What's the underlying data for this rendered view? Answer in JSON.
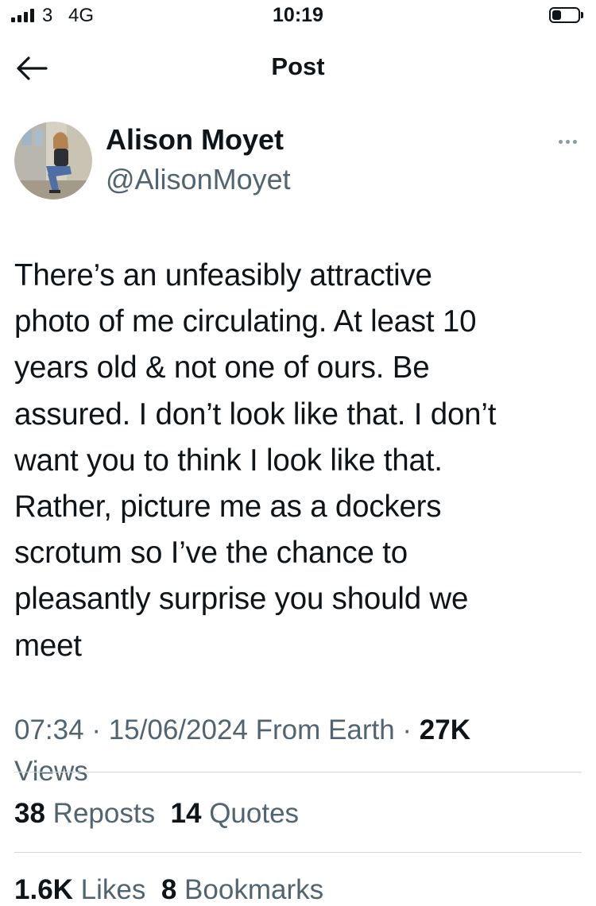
{
  "status_bar": {
    "carrier": "3",
    "network": "4G",
    "time": "10:19",
    "battery_level": 0.35,
    "icons": [
      "signal-bars-icon",
      "battery-icon"
    ]
  },
  "header": {
    "title": "Post",
    "back_icon": "arrow-left-icon"
  },
  "author": {
    "name": "Alison Moyet",
    "handle": "@AlisonMoyet",
    "more_icon": "more-horizontal-icon"
  },
  "tweet": {
    "lines": [
      "There’s an unfeasibly attractive",
      "photo of me circulating. At least 10",
      "years old & not one of ours. Be",
      "assured. I don’t  look like that. I don’t",
      "want you to think I look like that.",
      "Rather, picture me as a dockers",
      "scrotum so I’ve the chance to",
      "pleasantly surprise you should we",
      "meet"
    ]
  },
  "meta": {
    "time": "07:34",
    "date": "15/06/2024",
    "source": "From Earth",
    "separator": "·",
    "views_count": "27K",
    "views_label": "Views"
  },
  "stats": {
    "reposts_count": "38",
    "reposts_label": "Reposts",
    "quotes_count": "14",
    "quotes_label": "Quotes",
    "likes_count": "1.6K",
    "likes_label": "Likes",
    "bookmarks_count": "8",
    "bookmarks_label": "Bookmarks"
  },
  "colors": {
    "text_primary": "#0f1419",
    "text_secondary": "#536471",
    "divider": "#cfd9de"
  }
}
